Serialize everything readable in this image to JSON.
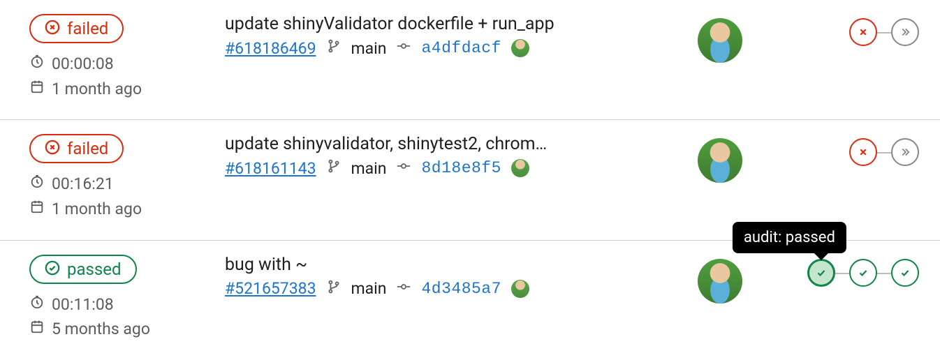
{
  "pipelines": [
    {
      "status": "failed",
      "status_label": "failed",
      "duration": "00:00:08",
      "age": "1 month ago",
      "commit_title": "update shinyValidator dockerfile + run_app",
      "pipeline_id": "#618186469",
      "branch": "main",
      "commit_sha": "a4dfdacf",
      "stages": [
        "failed",
        "skipped"
      ]
    },
    {
      "status": "failed",
      "status_label": "failed",
      "duration": "00:16:21",
      "age": "1 month ago",
      "commit_title": "update shinyvalidator, shinytest2, chrom…",
      "pipeline_id": "#618161143",
      "branch": "main",
      "commit_sha": "8d18e8f5",
      "stages": [
        "failed",
        "skipped"
      ]
    },
    {
      "status": "passed",
      "status_label": "passed",
      "duration": "00:11:08",
      "age": "5 months ago",
      "commit_title": "bug with ~",
      "pipeline_id": "#521657383",
      "branch": "main",
      "commit_sha": "4d3485a7",
      "stages": [
        "passed",
        "passed",
        "passed"
      ],
      "tooltip": "audit: passed",
      "tooltip_stage_index": 0
    }
  ]
}
